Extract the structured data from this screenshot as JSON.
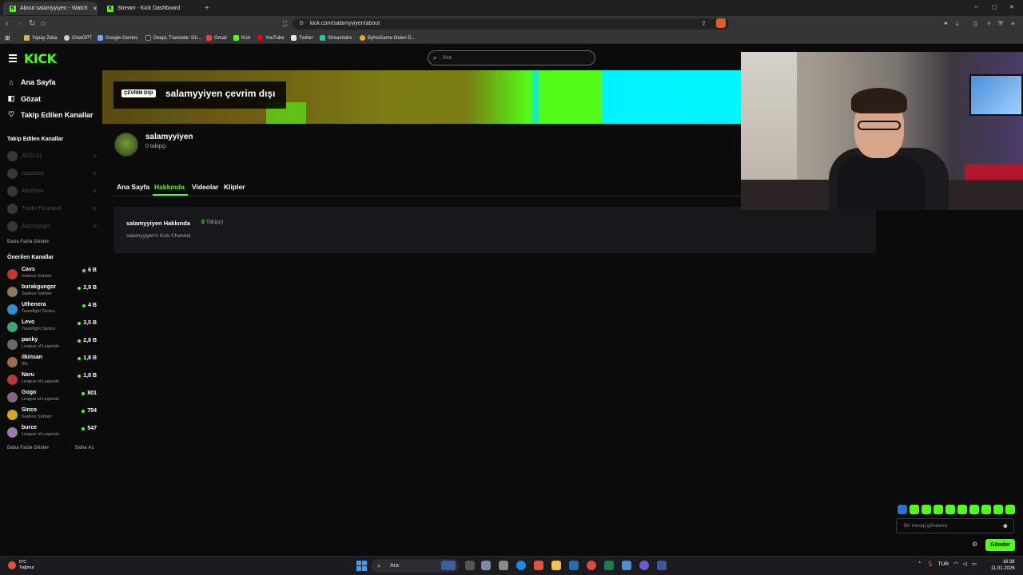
{
  "browser": {
    "tabs": [
      {
        "title": "About salamyyiyen - Watch Live",
        "active": true
      },
      {
        "title": "Stream - Kick Dashboard",
        "active": false
      }
    ],
    "new_tab": "+",
    "url": "kick.com/salamyyiyen/about",
    "window_controls": {
      "minimize": "–",
      "maximize": "▢",
      "close": "✕"
    }
  },
  "bookmarks": [
    {
      "label": "Yapay Zeka",
      "color": "#d8b35c"
    },
    {
      "label": "ChatGPT",
      "color": "#cfcfcf"
    },
    {
      "label": "Google Gemini",
      "color": "#7aa2ff"
    },
    {
      "label": "DeepL Translate: Dü...",
      "color": "#0f2b46"
    },
    {
      "label": "Gmail",
      "color": "#e94335"
    },
    {
      "label": "Kick",
      "color": "#53fc18"
    },
    {
      "label": "YouTube",
      "color": "#ff0000"
    },
    {
      "label": "Twitter",
      "color": "#e7e7e7"
    },
    {
      "label": "Streamlabs",
      "color": "#31c3a2"
    },
    {
      "label": "ByNoGame Gelen D...",
      "color": "#f5a623"
    }
  ],
  "header": {
    "logo": "KICK",
    "search_placeholder": "Ara"
  },
  "sidebar": {
    "nav": [
      {
        "label": "Ana Sayfa",
        "icon": "home-icon",
        "glyph": "⌂"
      },
      {
        "label": "Gözat",
        "icon": "compass-icon",
        "glyph": "◧"
      },
      {
        "label": "Takip Edilen Kanallar",
        "icon": "heart-icon",
        "glyph": "♡"
      }
    ],
    "followed_heading": "Takip Edilen Kanallar",
    "followed": [
      "ADZL31",
      "oguzsasi",
      "Aesthrax",
      "TraderThrandull",
      "AlpOzgirgin"
    ],
    "followed_more": "Daha Fazla Göster",
    "recommended_heading": "Önerilen Kanallar",
    "recommended": [
      {
        "name": "Cavs",
        "category": "Sadece Sohbet",
        "viewers": "6 B",
        "color": "#c0392b"
      },
      {
        "name": "burakgungor",
        "category": "Sadece Sohbet",
        "viewers": "2,9 B",
        "color": "#8e7a5a"
      },
      {
        "name": "Uthenera",
        "category": "Teamfight Tactics",
        "viewers": "4 B",
        "color": "#2f8fd1"
      },
      {
        "name": "Levo",
        "category": "Teamfight Tactics",
        "viewers": "3,5 B",
        "color": "#3aa57a"
      },
      {
        "name": "panky",
        "category": "League of Legends",
        "viewers": "2,8 B",
        "color": "#6a6a6a"
      },
      {
        "name": "ilkinsan",
        "category": "IRL",
        "viewers": "1,8 B",
        "color": "#a06a50"
      },
      {
        "name": "Naru",
        "category": "League of Legends",
        "viewers": "1,8 B",
        "color": "#b23a3a"
      },
      {
        "name": "Gogo",
        "category": "League of Legends",
        "viewers": "801",
        "color": "#7a6a8a"
      },
      {
        "name": "Sinco",
        "category": "Sadece Sohbet",
        "viewers": "754",
        "color": "#d9a521"
      },
      {
        "name": "burce",
        "category": "League of Legends",
        "viewers": "547",
        "color": "#9a7aa8"
      }
    ],
    "show_more": "Daha Fazla Göster",
    "show_less": "Daha Az"
  },
  "channel": {
    "offline_badge": "ÇEVRİM DIŞI",
    "offline_title": "salamyyiyen çevrim dışı",
    "name": "salamyyiyen",
    "followers": "0 takipçi",
    "tabs": [
      "Ana Sayfa",
      "Hakkında",
      "Videolar",
      "Klipler"
    ],
    "active_tab": "Hakkında",
    "about_title": "salamyyiyen Hakkında",
    "about_followers_count": "0",
    "about_followers_label": "Takipçi",
    "about_description": "salamyyiyen's Kick Channel"
  },
  "chat": {
    "placeholder": "Bir mesaj gönderin",
    "send": "Gönder"
  },
  "taskbar": {
    "weather_temp": "5°C",
    "weather_desc": "Yağmur",
    "search": "Ara",
    "lang": "TUR",
    "time": "16:38",
    "date": "11.01.2026"
  }
}
